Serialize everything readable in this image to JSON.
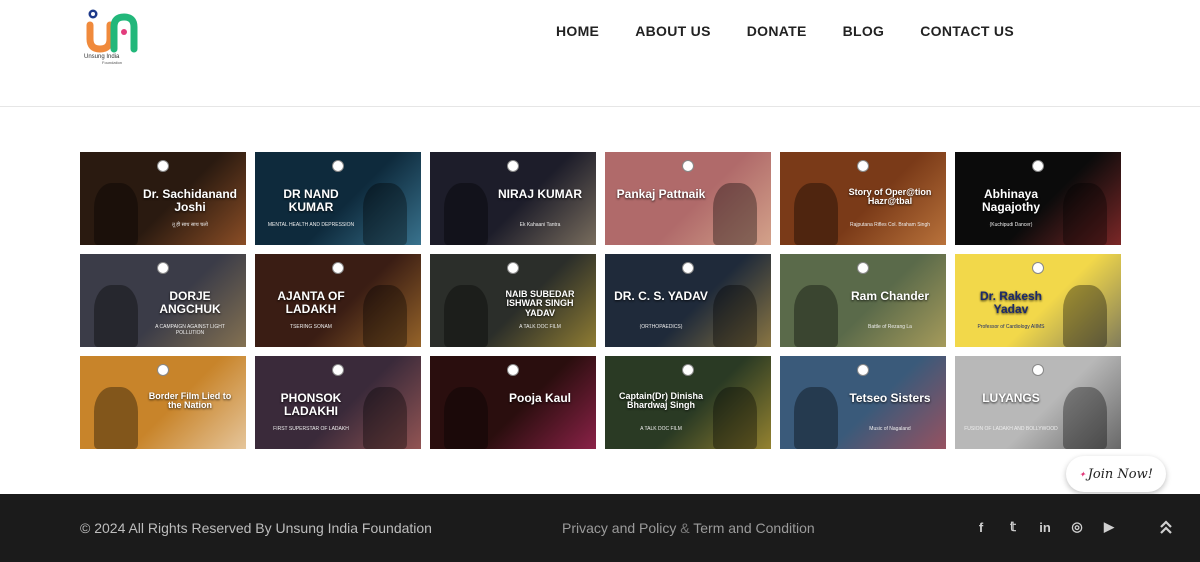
{
  "brand": {
    "logo_letters": "un",
    "name": "Unsung India",
    "name_sub": "Foundation"
  },
  "nav": {
    "items": [
      {
        "label": "HOME"
      },
      {
        "label": "ABOUT US"
      },
      {
        "label": "DONATE"
      },
      {
        "label": "BLOG"
      },
      {
        "label": "CONTACT US"
      }
    ]
  },
  "gallery": {
    "tiles": [
      {
        "title": "Dr. Sachidanand Joshi",
        "sub": "तू ही साथ साथ चलो",
        "bg": "#2a1a10",
        "accent": "#e07b39"
      },
      {
        "title": "DR NAND KUMAR",
        "sub": "MENTAL HEALTH AND DEPRESSION",
        "bg": "#0e2a3c",
        "accent": "#5fb3d6"
      },
      {
        "title": "NIRAJ KUMAR",
        "sub": "Ek Kahaani Tantra",
        "bg": "#1d1d2a",
        "accent": "#c9b38a"
      },
      {
        "title": "Pankaj Pattnaik",
        "sub": "",
        "bg": "#b06a6a",
        "accent": "#f2d3a6"
      },
      {
        "title": "Story of Oper@tion Hazr@tbal",
        "sub": "Rajputana Rifles Col. Braham Singh",
        "bg": "#7a3a18",
        "accent": "#f0a45a"
      },
      {
        "title": "Abhinaya Nagajothy",
        "sub": "(Kuchipudi Dancer)",
        "bg": "#0b0b0b",
        "accent": "#e04040"
      },
      {
        "title": "DORJE ANGCHUK",
        "sub": "A CAMPAIGN AGAINST LIGHT POLLUTION",
        "bg": "#3b3c48",
        "accent": "#c4a05a"
      },
      {
        "title": "AJANTA OF LADAKH",
        "sub": "TSERING SONAM",
        "bg": "#3a1d14",
        "accent": "#e6a23c"
      },
      {
        "title": "NAIB SUBEDAR ISHWAR SINGH YADAV",
        "sub": "A TALK DOC FILM",
        "bg": "#2b2e2a",
        "accent": "#e8c23a"
      },
      {
        "title": "DR. C. S. YADAV",
        "sub": "(ORTHOPAEDICS)",
        "bg": "#1f2a3a",
        "accent": "#e8b84a"
      },
      {
        "title": "Ram Chander",
        "sub": "Battle of Rezang La",
        "bg": "#5a6a4a",
        "accent": "#e8c66a"
      },
      {
        "title": "Dr. Rakesh Yadav",
        "sub": "Professor of Cardiology AIIMS",
        "bg": "#f2d84a",
        "accent": "#1c2a6a"
      },
      {
        "title": "Border Film Lied to the Nation",
        "sub": "",
        "bg": "#c8842a",
        "accent": "#ffffff"
      },
      {
        "title": "PHONSOK LADAKHI",
        "sub": "FIRST SUPERSTAR OF LADAKH",
        "bg": "#3a2a3a",
        "accent": "#e07a6a"
      },
      {
        "title": "Pooja Kaul",
        "sub": "",
        "bg": "#2a0e0e",
        "accent": "#e0337a"
      },
      {
        "title": "Captain(Dr) Dinisha Bhardwaj Singh",
        "sub": "A TALK DOC FILM",
        "bg": "#2a3a24",
        "accent": "#f2c23a"
      },
      {
        "title": "Tetseo Sisters",
        "sub": "Music of Nagaland",
        "bg": "#3a5a7a",
        "accent": "#e84a4a"
      },
      {
        "title": "LUYANGS",
        "sub": "FUSION OF LADAKH AND BOLLYWOOD",
        "bg": "#b8b8b8",
        "accent": "#222222"
      }
    ]
  },
  "join": {
    "label": "Join Now!"
  },
  "footer": {
    "copyright": "© 2024 All Rights Reserved By Unsung India Foundation",
    "privacy": "Privacy and Policy",
    "amp": "&",
    "terms": "Term and Condition",
    "social": [
      {
        "icon": "facebook-icon",
        "glyph": "f"
      },
      {
        "icon": "twitter-icon",
        "glyph": "𝕥"
      },
      {
        "icon": "linkedin-icon",
        "glyph": "in"
      },
      {
        "icon": "instagram-icon",
        "glyph": "◎"
      },
      {
        "icon": "youtube-icon",
        "glyph": "▶"
      }
    ]
  }
}
